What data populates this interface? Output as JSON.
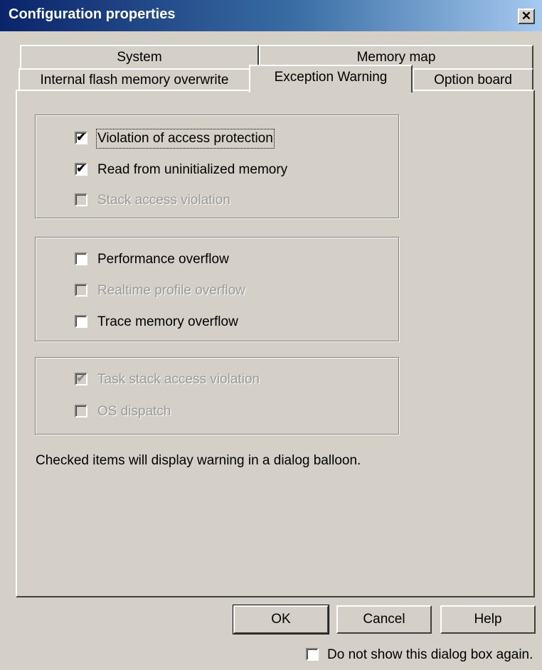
{
  "window": {
    "title": "Configuration properties",
    "close_glyph": "✕"
  },
  "tabs": {
    "row_back": [
      "System",
      "Memory map"
    ],
    "row_front": [
      "Internal flash memory overwrite",
      "Exception Warning",
      "Option board"
    ],
    "active": "Exception Warning"
  },
  "groups": [
    {
      "options": [
        {
          "label": "Violation of access protection",
          "checked": true,
          "enabled": true,
          "focused": true
        },
        {
          "label": "Read from uninitialized memory",
          "checked": true,
          "enabled": true
        },
        {
          "label": "Stack access violation",
          "checked": false,
          "enabled": false
        }
      ]
    },
    {
      "options": [
        {
          "label": "Performance overflow",
          "checked": false,
          "enabled": true
        },
        {
          "label": "Realtime profile overflow",
          "checked": false,
          "enabled": false
        },
        {
          "label": "Trace memory overflow",
          "checked": false,
          "enabled": true
        }
      ]
    },
    {
      "options": [
        {
          "label": "Task stack access violation",
          "checked": true,
          "enabled": false
        },
        {
          "label": "OS dispatch",
          "checked": false,
          "enabled": false
        }
      ]
    }
  ],
  "note": "Checked items will display warning in a dialog balloon.",
  "buttons": {
    "ok": "OK",
    "cancel": "Cancel",
    "help": "Help"
  },
  "footer": {
    "dont_show_label": "Do not show this dialog box again.",
    "dont_show_checked": false
  },
  "icons": {
    "checkmark": "✔"
  }
}
